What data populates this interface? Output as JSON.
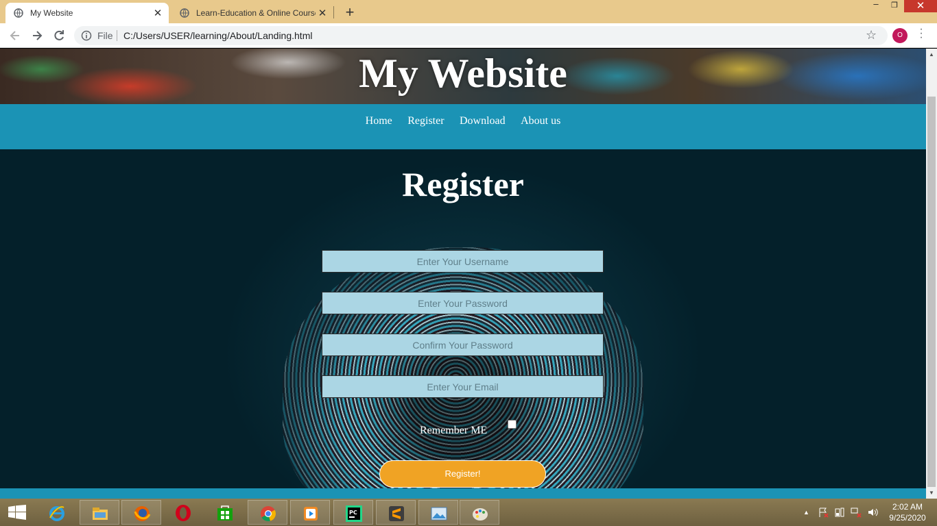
{
  "browser": {
    "tabs": [
      {
        "title": "My Website",
        "close": "✕"
      },
      {
        "title": "Learn-Education & Online Course",
        "close": "✕"
      }
    ],
    "new_tab": "+",
    "window_controls": {
      "minimize": "–",
      "maximize": "❐",
      "close": "✕"
    },
    "address": {
      "scheme_label": "File",
      "url": "C:/Users/USER/learning/About/Landing.html"
    },
    "star": "☆",
    "profile_initial": "O",
    "menu": "⋮"
  },
  "site": {
    "title": "My Website",
    "nav": [
      "Home",
      "Register",
      "Download",
      "About us"
    ]
  },
  "form": {
    "heading": "Register",
    "username_placeholder": "Enter Your Username",
    "password_placeholder": "Enter Your Password",
    "confirm_placeholder": "Confirm Your Password",
    "email_placeholder": "Enter Your Email",
    "remember_label": "Remember ME",
    "submit_label": "Register!"
  },
  "taskbar": {
    "apps": [
      "windows-start-icon",
      "internet-explorer-icon",
      "file-explorer-icon",
      "firefox-icon",
      "opera-icon",
      "store-icon",
      "chrome-icon",
      "media-player-icon",
      "pycharm-icon",
      "sublime-text-icon",
      "photos-icon",
      "paint-icon"
    ],
    "clock_time": "2:02 AM",
    "clock_date": "9/25/2020"
  },
  "colors": {
    "tabstrip": "#e8c98c",
    "navbar": "#1b93b5",
    "field_bg": "#abd6e4",
    "button": "#f0a324",
    "background": "#05232e"
  }
}
